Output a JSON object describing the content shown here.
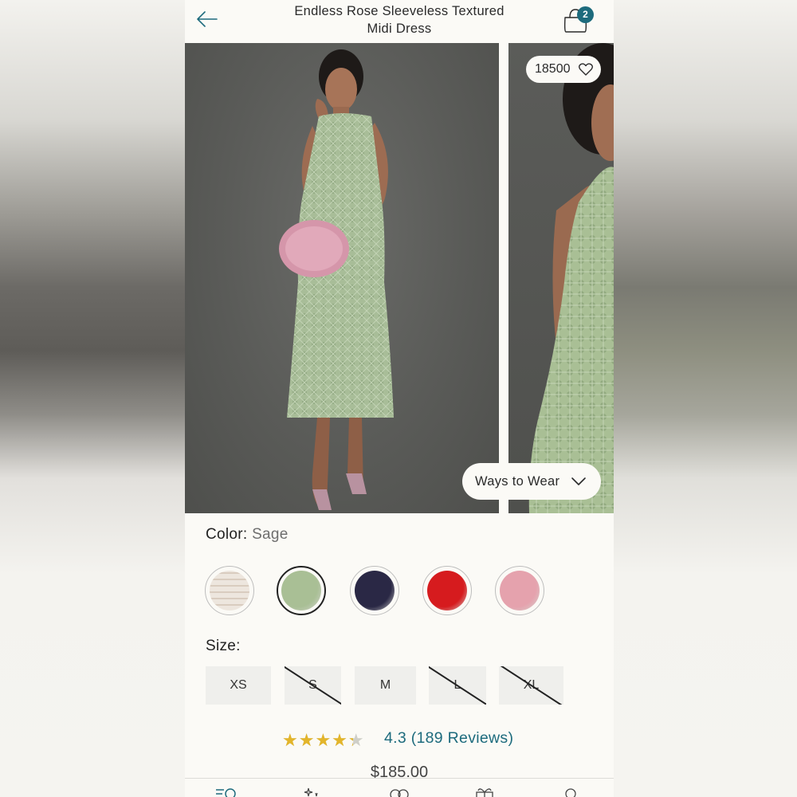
{
  "header": {
    "title_line1": "Endless Rose Sleeveless Textured",
    "title_line2": "Midi Dress",
    "bag_count": "2"
  },
  "gallery": {
    "likes": "18500",
    "ways_to_wear": "Ways to Wear"
  },
  "color": {
    "label": "Color:",
    "selected": "Sage",
    "swatches": [
      {
        "name": "Ivory",
        "color": "#e8ddd3"
      },
      {
        "name": "Sage",
        "color": "#a9bf95"
      },
      {
        "name": "Navy",
        "color": "#2a2845"
      },
      {
        "name": "Red",
        "color": "#d61b1e"
      },
      {
        "name": "Pink",
        "color": "#e5a2ad"
      }
    ]
  },
  "size": {
    "label": "Size:",
    "options": [
      {
        "label": "XS",
        "available": true
      },
      {
        "label": "S",
        "available": false
      },
      {
        "label": "M",
        "available": true
      },
      {
        "label": "L",
        "available": false
      },
      {
        "label": "XL",
        "available": false
      }
    ]
  },
  "rating": {
    "stars": "★★★★★",
    "value": 4.3,
    "text": "4.3 (189 Reviews)"
  },
  "price": "$185.00",
  "colors": {
    "accent": "#1d6b7d",
    "star": "#e3b52a"
  }
}
